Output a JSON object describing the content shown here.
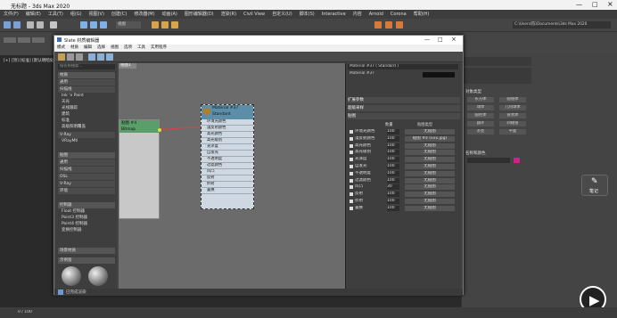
{
  "app": {
    "title": "无标题 - 3ds Max 2020"
  },
  "menus": [
    "文件(F)",
    "编辑(E)",
    "工具(T)",
    "组(G)",
    "视图(V)",
    "创建(C)",
    "修改器(M)",
    "动画(A)",
    "图形编辑器(D)",
    "渲染(R)",
    "Civil View",
    "自定义(U)",
    "脚本(S)",
    "Interactive",
    "内容",
    "Arnold",
    "Corona",
    "帮助(H)"
  ],
  "toolbar": {
    "view_dropdown": "视图",
    "search_text": "C:\\Users\\陈\\Documents\\3ds Max 2020"
  },
  "viewport": {
    "label": "[+] [顶] [标准] [默认明暗处理]"
  },
  "slate": {
    "title": "Slate 材质编辑器",
    "menus": [
      "模式",
      "材质",
      "编辑",
      "选择",
      "视图",
      "选项",
      "工具",
      "实用程序"
    ],
    "browser": {
      "search_placeholder": "按名称搜索...",
      "groups": [
        "材质",
        "通用",
        "扫描线",
        "V-Ray",
        "贴图",
        "通用",
        "扫描线",
        "OSL",
        "V-Ray",
        "环境",
        "控制器",
        "场景材质",
        "示例窗"
      ],
      "items": [
        "Ink 'n Paint",
        "天光",
        "光线跟踪",
        "建筑",
        "标准",
        "高级照明覆盖",
        "VRayMtl",
        "Float 控制器",
        "Point3 控制器",
        "Point4 控制器",
        "变换控制器"
      ]
    },
    "view_tab": "视图1",
    "nodes": {
      "map_node": {
        "label": "贴图 #4",
        "sub": "Bitmap"
      },
      "mat_node": {
        "label": "Material #37",
        "sub": "Standard",
        "slots": [
          "环境光颜色",
          "漫反射颜色",
          "高光颜色",
          "高光级别",
          "光泽度",
          "自发光",
          "不透明度",
          "过滤颜色",
          "凹凸",
          "反射",
          "折射",
          "置换"
        ]
      }
    },
    "params": {
      "title": "Material #37 ( Standard )",
      "name": "Material #37",
      "sections": [
        "扩展参数",
        "超级采样",
        "贴图"
      ],
      "columns": [
        "数量",
        "贴图类型"
      ],
      "rows": [
        {
          "name": "环境光颜色",
          "amount": "100",
          "map": "无贴图"
        },
        {
          "name": "漫反射颜色",
          "amount": "100",
          "map": "贴图 #4 (xxx.jpg)"
        },
        {
          "name": "高光颜色",
          "amount": "100",
          "map": "无贴图"
        },
        {
          "name": "高光级别",
          "amount": "100",
          "map": "无贴图"
        },
        {
          "name": "光泽度",
          "amount": "100",
          "map": "无贴图"
        },
        {
          "name": "自发光",
          "amount": "100",
          "map": "无贴图"
        },
        {
          "name": "不透明度",
          "amount": "100",
          "map": "无贴图"
        },
        {
          "name": "过滤颜色",
          "amount": "100",
          "map": "无贴图"
        },
        {
          "name": "凹凸",
          "amount": "30",
          "map": "无贴图"
        },
        {
          "name": "反射",
          "amount": "100",
          "map": "无贴图"
        },
        {
          "name": "折射",
          "amount": "100",
          "map": "无贴图"
        },
        {
          "name": "置换",
          "amount": "100",
          "map": "无贴图"
        }
      ]
    },
    "status": "已完成渲染"
  },
  "rightpanel": {
    "section1": "对象类型",
    "buttons": [
      "长方体",
      "圆锥体",
      "球体",
      "几何球体",
      "圆柱体",
      "管状体",
      "圆环",
      "四棱锥",
      "茶壶",
      "平面"
    ],
    "section2": "名称和颜色",
    "accent": "#d0218a"
  },
  "notes_button": "笔记",
  "status": {
    "frame": "0 / 100"
  }
}
